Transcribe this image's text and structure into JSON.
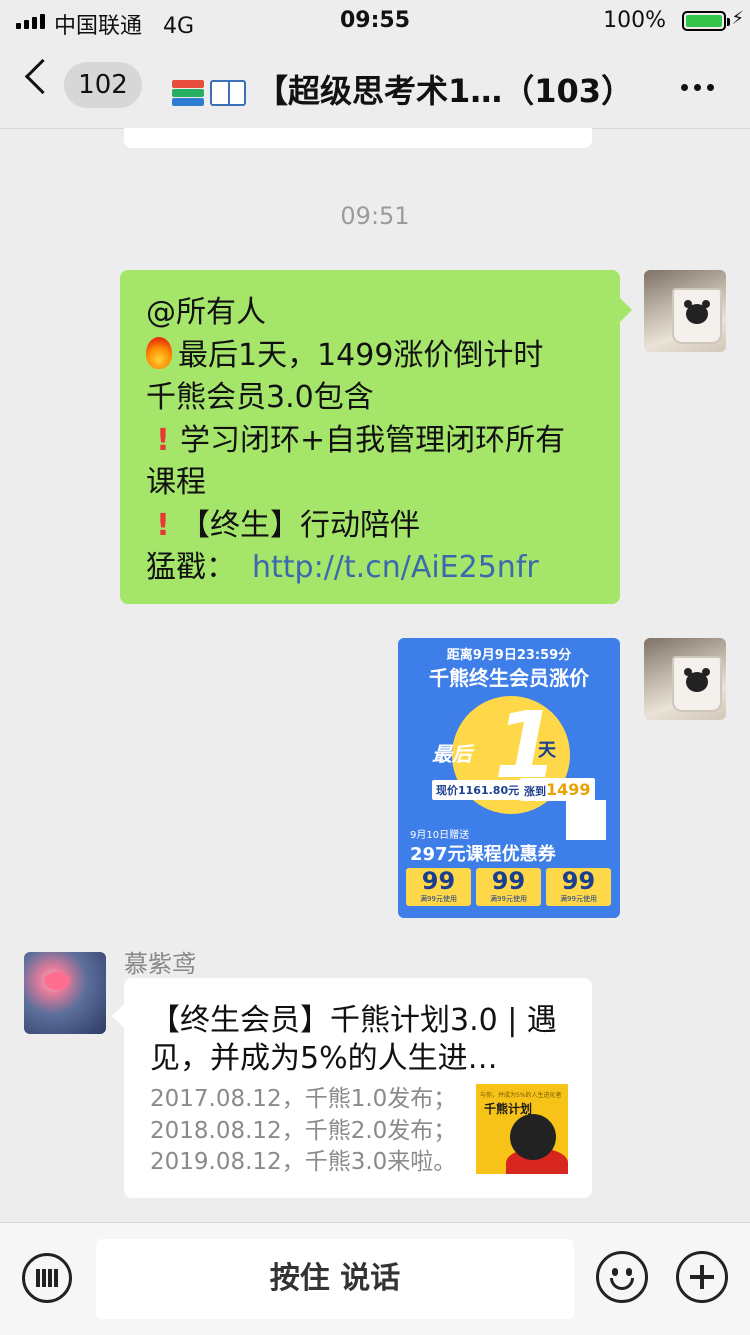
{
  "status_bar": {
    "carrier": "中国联通",
    "network": "4G",
    "time": "09:55",
    "battery": "100%"
  },
  "nav": {
    "unread_count": "102",
    "title": "【超级思考术1…（103）",
    "title_icons": [
      "books-icon",
      "open-book-icon"
    ]
  },
  "chat": {
    "timestamp": "09:51",
    "message1": {
      "lines": [
        "@所有人",
        "最后1天，1499涨价倒计时",
        "千熊会员3.0包含",
        "学习闭环+自我管理闭环所有课程",
        "【终生】行动陪伴"
      ],
      "link_label": "猛戳：",
      "link": "http://t.cn/AiE25nfr"
    },
    "poster": {
      "line1": "距离9月9日23:59分",
      "line2": "千熊终生会员涨价",
      "big_number": "1",
      "left_word": "最后",
      "right_word": "天",
      "price_now": "现价1161.80元",
      "price_rise_label": "涨到",
      "price_rise": "1499",
      "gift_date": "9月10日赠送",
      "coupon_title": "297元课程优惠券",
      "coupons": [
        {
          "value": "99",
          "note": "满99元使用"
        },
        {
          "value": "99",
          "note": "满99元使用"
        },
        {
          "value": "99",
          "note": "满99元使用"
        }
      ]
    },
    "message3": {
      "sender": "慕紫鸢",
      "card_title": "【终生会员】千熊计划3.0 | 遇见，并成为5%的人生进…",
      "card_desc": [
        "2017.08.12，千熊1.0发布；",
        "2018.08.12，千熊2.0发布；",
        "2019.08.12，千熊3.0来啦。"
      ],
      "thumb_small": "与你，并成为5%的人生进化者",
      "thumb_title": "千熊计划"
    }
  },
  "input_bar": {
    "hold_to_talk": "按住 说话"
  }
}
